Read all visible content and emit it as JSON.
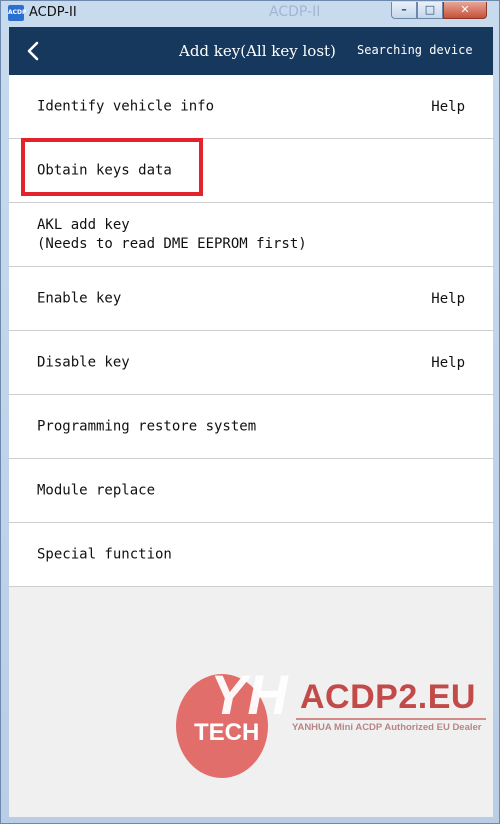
{
  "window": {
    "title": "ACDP-II",
    "icon_label": "ACDP",
    "ghost_title": "ACDP-II",
    "min_symbol": "–",
    "max_symbol": "□",
    "close_symbol": "✕"
  },
  "header": {
    "back_icon": "chevron-left-icon",
    "title": "Add key(All key lost)",
    "status": "Searching device",
    "background": "#16385c"
  },
  "menu": {
    "items": [
      {
        "label": "Identify vehicle info",
        "help": "Help"
      },
      {
        "label": "Obtain keys data",
        "help": ""
      },
      {
        "label": "AKL add key\n(Needs to read DME EEPROM first)",
        "help": ""
      },
      {
        "label": "Enable key",
        "help": "Help"
      },
      {
        "label": "Disable key",
        "help": "Help"
      },
      {
        "label": "Programming restore system",
        "help": ""
      },
      {
        "label": "Module replace",
        "help": ""
      },
      {
        "label": "Special function",
        "help": ""
      }
    ],
    "highlight_color": "#e3232b"
  },
  "watermark": {
    "logo_text": "YH",
    "logo_sub": "TECH",
    "site": "ACDP2.EU",
    "tagline": "YANHUA Mini ACDP Authorized EU Dealer"
  }
}
